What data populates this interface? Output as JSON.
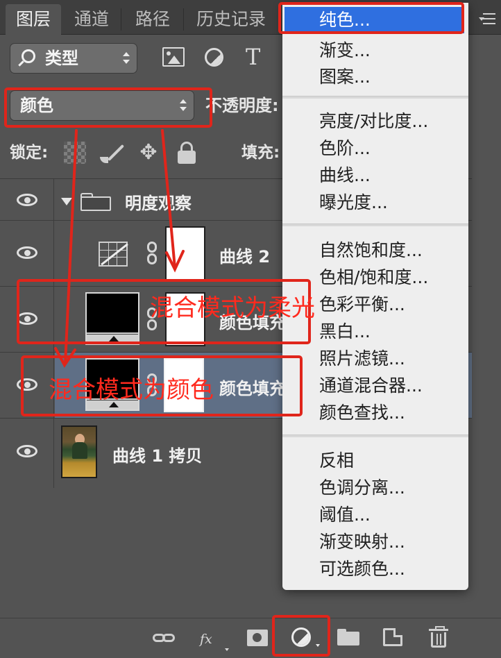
{
  "tabs": [
    "图层",
    "通道",
    "路径",
    "历史记录"
  ],
  "filter": {
    "kind_label": "类型",
    "type_icon_glyph": "T"
  },
  "blend_mode": "颜色",
  "opacity_label": "不透明度:",
  "lock_label": "锁定:",
  "fill_label": "填充:",
  "lock_move_glyph": "✥",
  "layers": [
    {
      "name": "明度观察",
      "kind": "group"
    },
    {
      "name": "曲线 2",
      "kind": "curves"
    },
    {
      "name": "颜色填充",
      "kind": "fill"
    },
    {
      "name": "颜色填充",
      "kind": "fill",
      "selected": true
    },
    {
      "name": "曲线 1 拷贝",
      "kind": "pixel"
    }
  ],
  "bottom_toolbar": {
    "fx_label": "fx"
  },
  "adjustment_menu": {
    "groups": [
      [
        "纯色...",
        "渐变...",
        "图案..."
      ],
      [
        "亮度/对比度...",
        "色阶...",
        "曲线...",
        "曝光度..."
      ],
      [
        "自然饱和度...",
        "色相/饱和度...",
        "色彩平衡...",
        "黑白...",
        "照片滤镜...",
        "通道混合器...",
        "颜色查找..."
      ],
      [
        "反相",
        "色调分离...",
        "阈值...",
        "渐变映射...",
        "可选颜色..."
      ]
    ],
    "highlighted": "纯色..."
  },
  "annotations": {
    "soft_light_note": "混合模式为柔光",
    "color_note": "混合模式为颜色"
  },
  "colors": {
    "panel_bg": "#535353",
    "selected_row": "#5f6f86",
    "menu_highlight": "#2f6fe0",
    "annotation_red": "#e0251b"
  }
}
